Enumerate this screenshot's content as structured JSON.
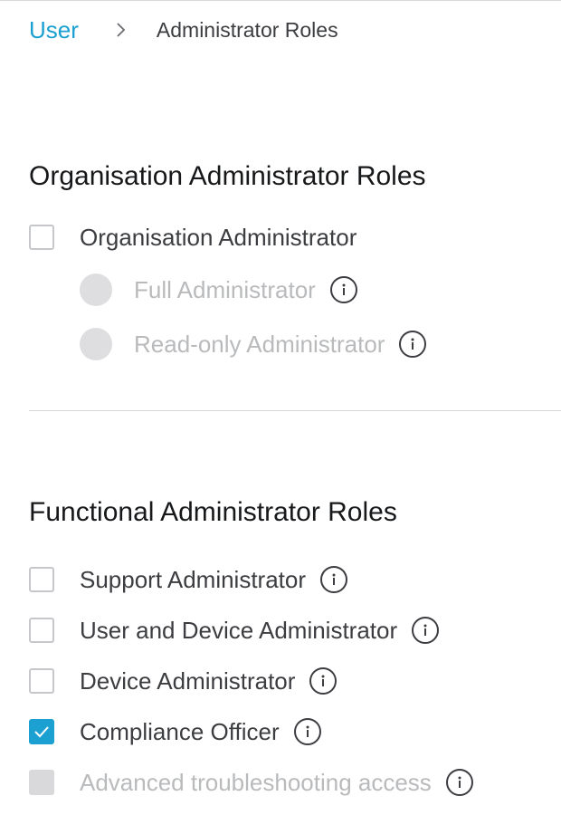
{
  "breadcrumb": {
    "parent": "User",
    "current": "Administrator Roles"
  },
  "organisation": {
    "title": "Organisation Administrator Roles",
    "main": {
      "label": "Organisation Administrator",
      "checked": false
    },
    "options": [
      {
        "label": "Full Administrator",
        "disabled": true
      },
      {
        "label": "Read-only Administrator",
        "disabled": true
      }
    ]
  },
  "functional": {
    "title": "Functional Administrator Roles",
    "items": [
      {
        "label": "Support Administrator",
        "checked": false,
        "disabled": false
      },
      {
        "label": "User and Device Administrator",
        "checked": false,
        "disabled": false
      },
      {
        "label": "Device Administrator",
        "checked": false,
        "disabled": false
      },
      {
        "label": "Compliance Officer",
        "checked": true,
        "disabled": false
      },
      {
        "label": "Advanced troubleshooting access",
        "checked": false,
        "disabled": true
      }
    ]
  },
  "icons": {
    "separator": "chevron-right-icon",
    "info": "info-icon",
    "check": "checkmark-icon"
  },
  "colors": {
    "accent": "#1ba0d1",
    "text": "#3c3d40",
    "disabled_text": "#b9babc",
    "disabled_fill": "#d9d9db"
  }
}
